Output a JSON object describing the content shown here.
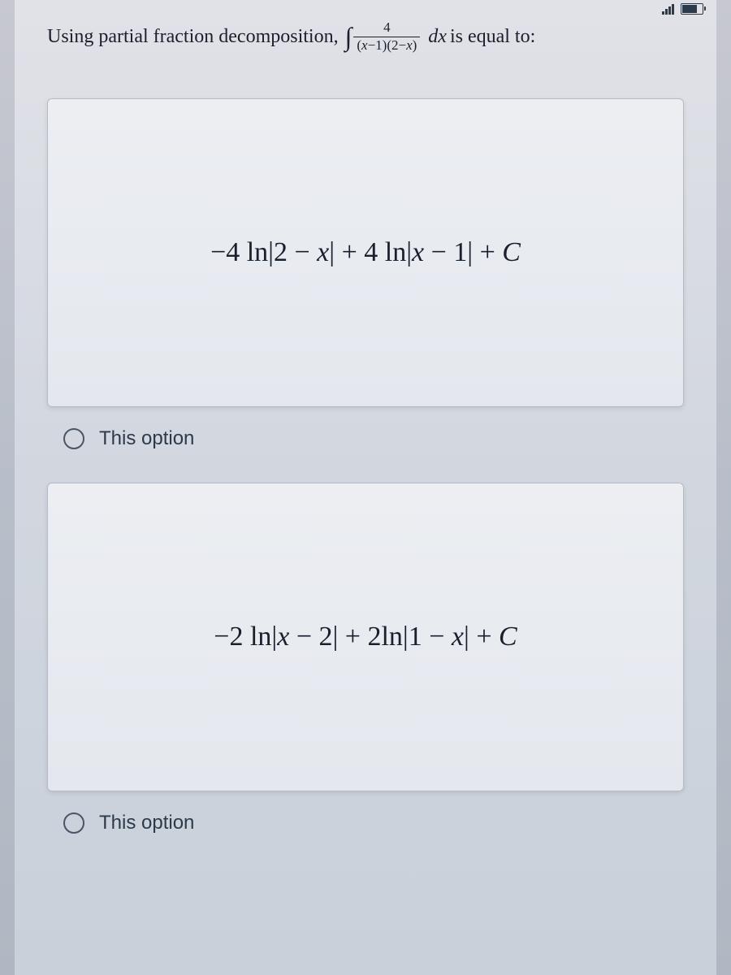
{
  "question": {
    "prefix": "Using partial fraction decomposition,",
    "integral_symbol": "∫",
    "numerator": "4",
    "denominator_left": "(",
    "denom_x1": "x",
    "denom_minus1": "−1)(2−",
    "denom_x2": "x",
    "denom_right": ")",
    "dx": "dx",
    "suffix": " is equal to:"
  },
  "options": [
    {
      "formula": "−4 ln|2 − x| + 4 ln|x − 1| + C",
      "label": "This option"
    },
    {
      "formula": "−2 ln|x − 2| + 2ln|1 − x| + C",
      "label": "This option"
    }
  ]
}
